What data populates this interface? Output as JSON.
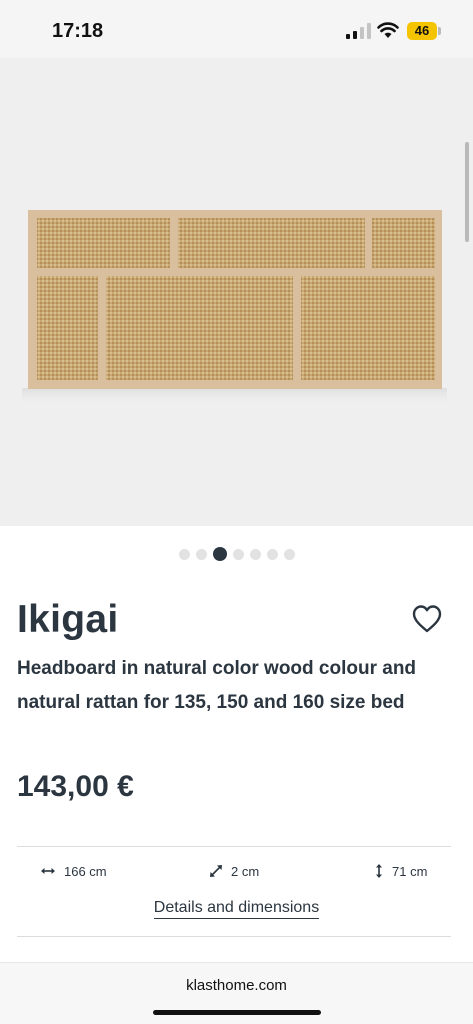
{
  "status_bar": {
    "time": "17:18",
    "battery": "46"
  },
  "gallery": {
    "image_name": "headboard-image",
    "dots_count": 7,
    "active_dot": 3
  },
  "product": {
    "name": "Ikigai",
    "description": "Headboard in natural color wood colour and natural rattan for 135, 150 and 160 size bed",
    "price": "143,00 €"
  },
  "dimensions": {
    "width": "166 cm",
    "depth": "2 cm",
    "height": "71 cm"
  },
  "details_link": "Details and dimensions",
  "browser": {
    "url": "klasthome.com"
  }
}
